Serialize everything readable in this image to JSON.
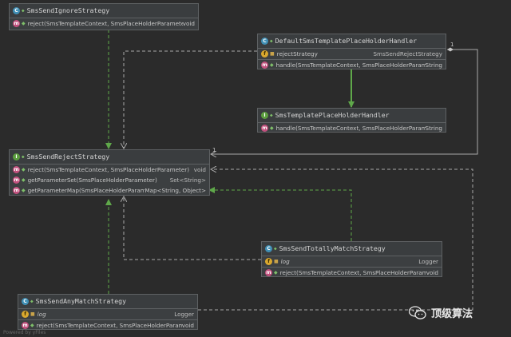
{
  "colors": {
    "background": "#2b2b2b",
    "box": "#3c3f41",
    "implements_arrow": "#5fa84a",
    "association_arrow": "#a9a9a9"
  },
  "boxes": {
    "ignore": {
      "title": "SmsSendIgnoreStrategy",
      "icon": "class-icon",
      "methods": [
        {
          "name": "reject(SmsTemplateContext, SmsPlaceHolderParameter)",
          "ret": "void"
        }
      ]
    },
    "default_handler": {
      "title": "DefaultSmsTemplatePlaceHolderHandler",
      "icon": "class-icon",
      "fields": [
        {
          "name": "rejectStrategy",
          "ret": "SmsSendRejectStrategy"
        }
      ],
      "methods": [
        {
          "name": "handle(SmsTemplateContext, SmsPlaceHolderParameter)",
          "ret": "String"
        }
      ]
    },
    "handler_iface": {
      "title": "SmsTemplatePlaceHolderHandler",
      "icon": "interface-icon",
      "methods": [
        {
          "name": "handle(SmsTemplateContext, SmsPlaceHolderParameter)",
          "ret": "String"
        }
      ]
    },
    "reject_iface": {
      "title": "SmsSendRejectStrategy",
      "icon": "interface-icon",
      "methods": [
        {
          "name": "reject(SmsTemplateContext, SmsPlaceHolderParameter)",
          "ret": "void"
        },
        {
          "name": "getParameterSet(SmsPlaceHolderParameter)",
          "ret": "Set<String>"
        },
        {
          "name": "getParameterMap(SmsPlaceHolderParameter)",
          "ret": "Map<String, Object>"
        }
      ]
    },
    "totally": {
      "title": "SmsSendTotallyMatchStrategy",
      "icon": "class-icon",
      "fields": [
        {
          "name": "log",
          "ret": "Logger"
        }
      ],
      "methods": [
        {
          "name": "reject(SmsTemplateContext, SmsPlaceHolderParameter)",
          "ret": "void"
        }
      ]
    },
    "any": {
      "title": "SmsSendAnyMatchStrategy",
      "icon": "class-icon",
      "fields": [
        {
          "name": "log",
          "ret": "Logger"
        }
      ],
      "methods": [
        {
          "name": "reject(SmsTemplateContext, SmsPlaceHolderParameter)",
          "ret": "void"
        }
      ]
    }
  },
  "multiplicity": {
    "source": "1",
    "target": "1"
  },
  "watermark": {
    "text": "顶级算法",
    "icon": "wechat-icon"
  },
  "footer_note": "Powered by yFiles"
}
